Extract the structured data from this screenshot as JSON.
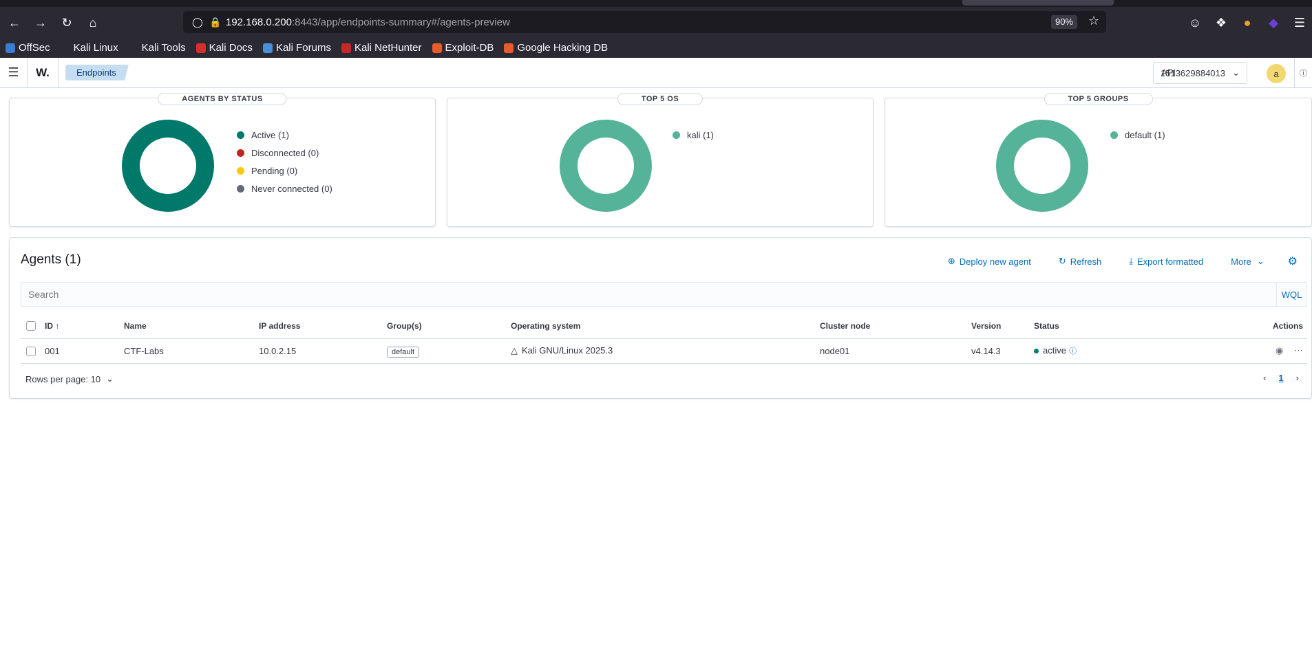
{
  "browser": {
    "url_host": "192.168.0.200",
    "url_rest": ":8443/app/endpoints-summary#/agents-preview",
    "zoom": "90%",
    "bookmarks": [
      {
        "label": "OffSec",
        "color": "#3a7bd5"
      },
      {
        "label": "Kali Linux",
        "color": "#2b2a33"
      },
      {
        "label": "Kali Tools",
        "color": "#2b2a33"
      },
      {
        "label": "Kali Docs",
        "color": "#d32f2f"
      },
      {
        "label": "Kali Forums",
        "color": "#4a90d9"
      },
      {
        "label": "Kali NetHunter",
        "color": "#c62828"
      },
      {
        "label": "Exploit-DB",
        "color": "#e65c2e"
      },
      {
        "label": "Google Hacking DB",
        "color": "#e65c2e"
      }
    ]
  },
  "header": {
    "logo": "W.",
    "breadcrumb": "Endpoints",
    "api_label": "API",
    "api_value": "1513629884013",
    "avatar": "a"
  },
  "cards": {
    "status": {
      "title": "AGENTS BY STATUS",
      "ring_color": "#00796b",
      "legend": [
        {
          "label": "Active (1)",
          "color": "#00796b"
        },
        {
          "label": "Disconnected (0)",
          "color": "#bd271e"
        },
        {
          "label": "Pending (0)",
          "color": "#fec514"
        },
        {
          "label": "Never connected (0)",
          "color": "#646a77"
        }
      ]
    },
    "os": {
      "title": "TOP 5 OS",
      "ring_color": "#54b399",
      "legend": [
        {
          "label": "kali (1)",
          "color": "#54b399"
        }
      ]
    },
    "groups": {
      "title": "TOP 5 GROUPS",
      "ring_color": "#54b399",
      "legend": [
        {
          "label": "default (1)",
          "color": "#54b399"
        }
      ]
    }
  },
  "agents": {
    "title": "Agents (1)",
    "actions": {
      "deploy": "Deploy new agent",
      "refresh": "Refresh",
      "export": "Export formatted",
      "more": "More"
    },
    "search_placeholder": "Search",
    "wql": "WQL",
    "columns": {
      "id": "ID",
      "name": "Name",
      "ip": "IP address",
      "groups": "Group(s)",
      "os": "Operating system",
      "cluster": "Cluster node",
      "version": "Version",
      "status": "Status",
      "actions": "Actions"
    },
    "rows": [
      {
        "id": "001",
        "name": "CTF-Labs",
        "ip": "10.0.2.15",
        "group": "default",
        "os": "Kali GNU/Linux 2025.3",
        "cluster": "node01",
        "version": "v4.14.3",
        "status": "active"
      }
    ],
    "rows_per_page": "Rows per page: 10",
    "page": "1"
  }
}
